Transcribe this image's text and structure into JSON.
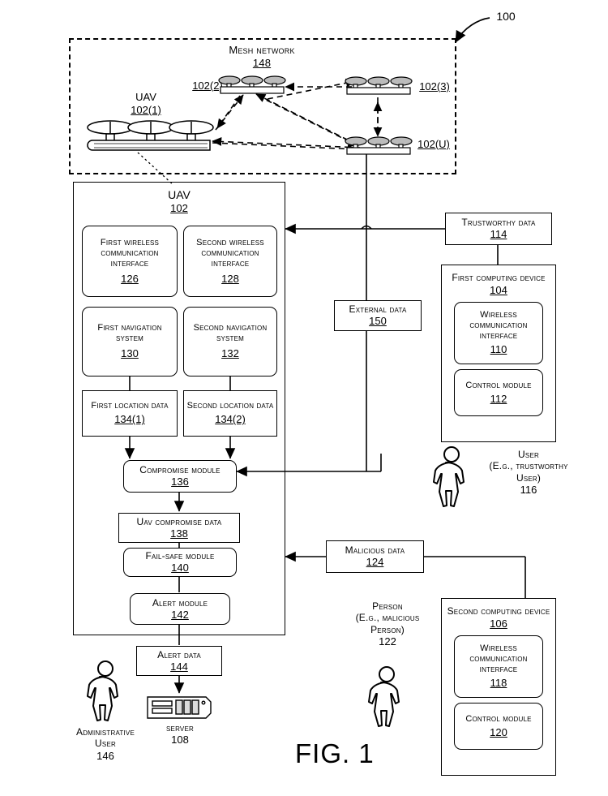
{
  "figure": {
    "caption": "FIG. 1",
    "system_ref": "100"
  },
  "mesh": {
    "title": "Mesh Network",
    "ref": "148",
    "uav_label": "UAV",
    "nodes": [
      {
        "id": "uav1",
        "ref": "102(1)"
      },
      {
        "id": "uav2",
        "ref": "102(2)"
      },
      {
        "id": "uav3",
        "ref": "102(3)"
      },
      {
        "id": "uavU",
        "ref": "102(U)"
      }
    ]
  },
  "uav": {
    "title": "UAV",
    "ref": "102",
    "components": [
      {
        "name": "first-wireless-communication-interface",
        "title": "First wireless communication interface",
        "ref": "126",
        "shape": "round"
      },
      {
        "name": "second-wireless-communication-interface",
        "title": "Second wireless communication interface",
        "ref": "128",
        "shape": "round"
      },
      {
        "name": "first-navigation-system",
        "title": "First navigation system",
        "ref": "130",
        "shape": "round"
      },
      {
        "name": "second-navigation-system",
        "title": "Second navigation system",
        "ref": "132",
        "shape": "round"
      },
      {
        "name": "first-location-data",
        "title": "First location data",
        "ref": "134(1)",
        "shape": "sharp"
      },
      {
        "name": "second-location-data",
        "title": "Second location data",
        "ref": "134(2)",
        "shape": "sharp"
      },
      {
        "name": "compromise-module",
        "title": "Compromise module",
        "ref": "136",
        "shape": "round"
      },
      {
        "name": "uav-compromise-data",
        "title": "UAV compromise data",
        "ref": "138",
        "shape": "sharp"
      },
      {
        "name": "fail-safe-module",
        "title": "Fail-safe module",
        "ref": "140",
        "shape": "round"
      },
      {
        "name": "alert-module",
        "title": "Alert module",
        "ref": "142",
        "shape": "round"
      }
    ]
  },
  "data_nodes": {
    "trustworthy": {
      "title": "Trustworthy data",
      "ref": "114"
    },
    "external": {
      "title": "External Data",
      "ref": "150"
    },
    "malicious": {
      "title": "Malicious data",
      "ref": "124"
    },
    "alert": {
      "title": "Alert data",
      "ref": "144"
    }
  },
  "first_computing_device": {
    "title": "First computing device",
    "ref": "104",
    "children": [
      {
        "name": "wireless-communication-interface",
        "title": "Wireless communication interface",
        "ref": "110"
      },
      {
        "name": "control-module",
        "title": "Control module",
        "ref": "112"
      }
    ]
  },
  "second_computing_device": {
    "title": "Second computing device",
    "ref": "106",
    "children": [
      {
        "name": "wireless-communication-interface",
        "title": "Wireless communication interface",
        "ref": "118"
      },
      {
        "name": "control-module",
        "title": "Control module",
        "ref": "120"
      }
    ]
  },
  "actors": {
    "trustworthy_user": {
      "line1": "User",
      "line2": "(e.g., trustworthy",
      "line3": "user)",
      "ref": "116"
    },
    "malicious_person": {
      "line1": "Person",
      "line2": "(e.g., malicious",
      "line3": "person)",
      "ref": "122"
    },
    "administrative_user": {
      "line1": "Administrative",
      "line2": "user",
      "ref": "146"
    }
  },
  "server": {
    "title": "Server",
    "ref": "108"
  }
}
